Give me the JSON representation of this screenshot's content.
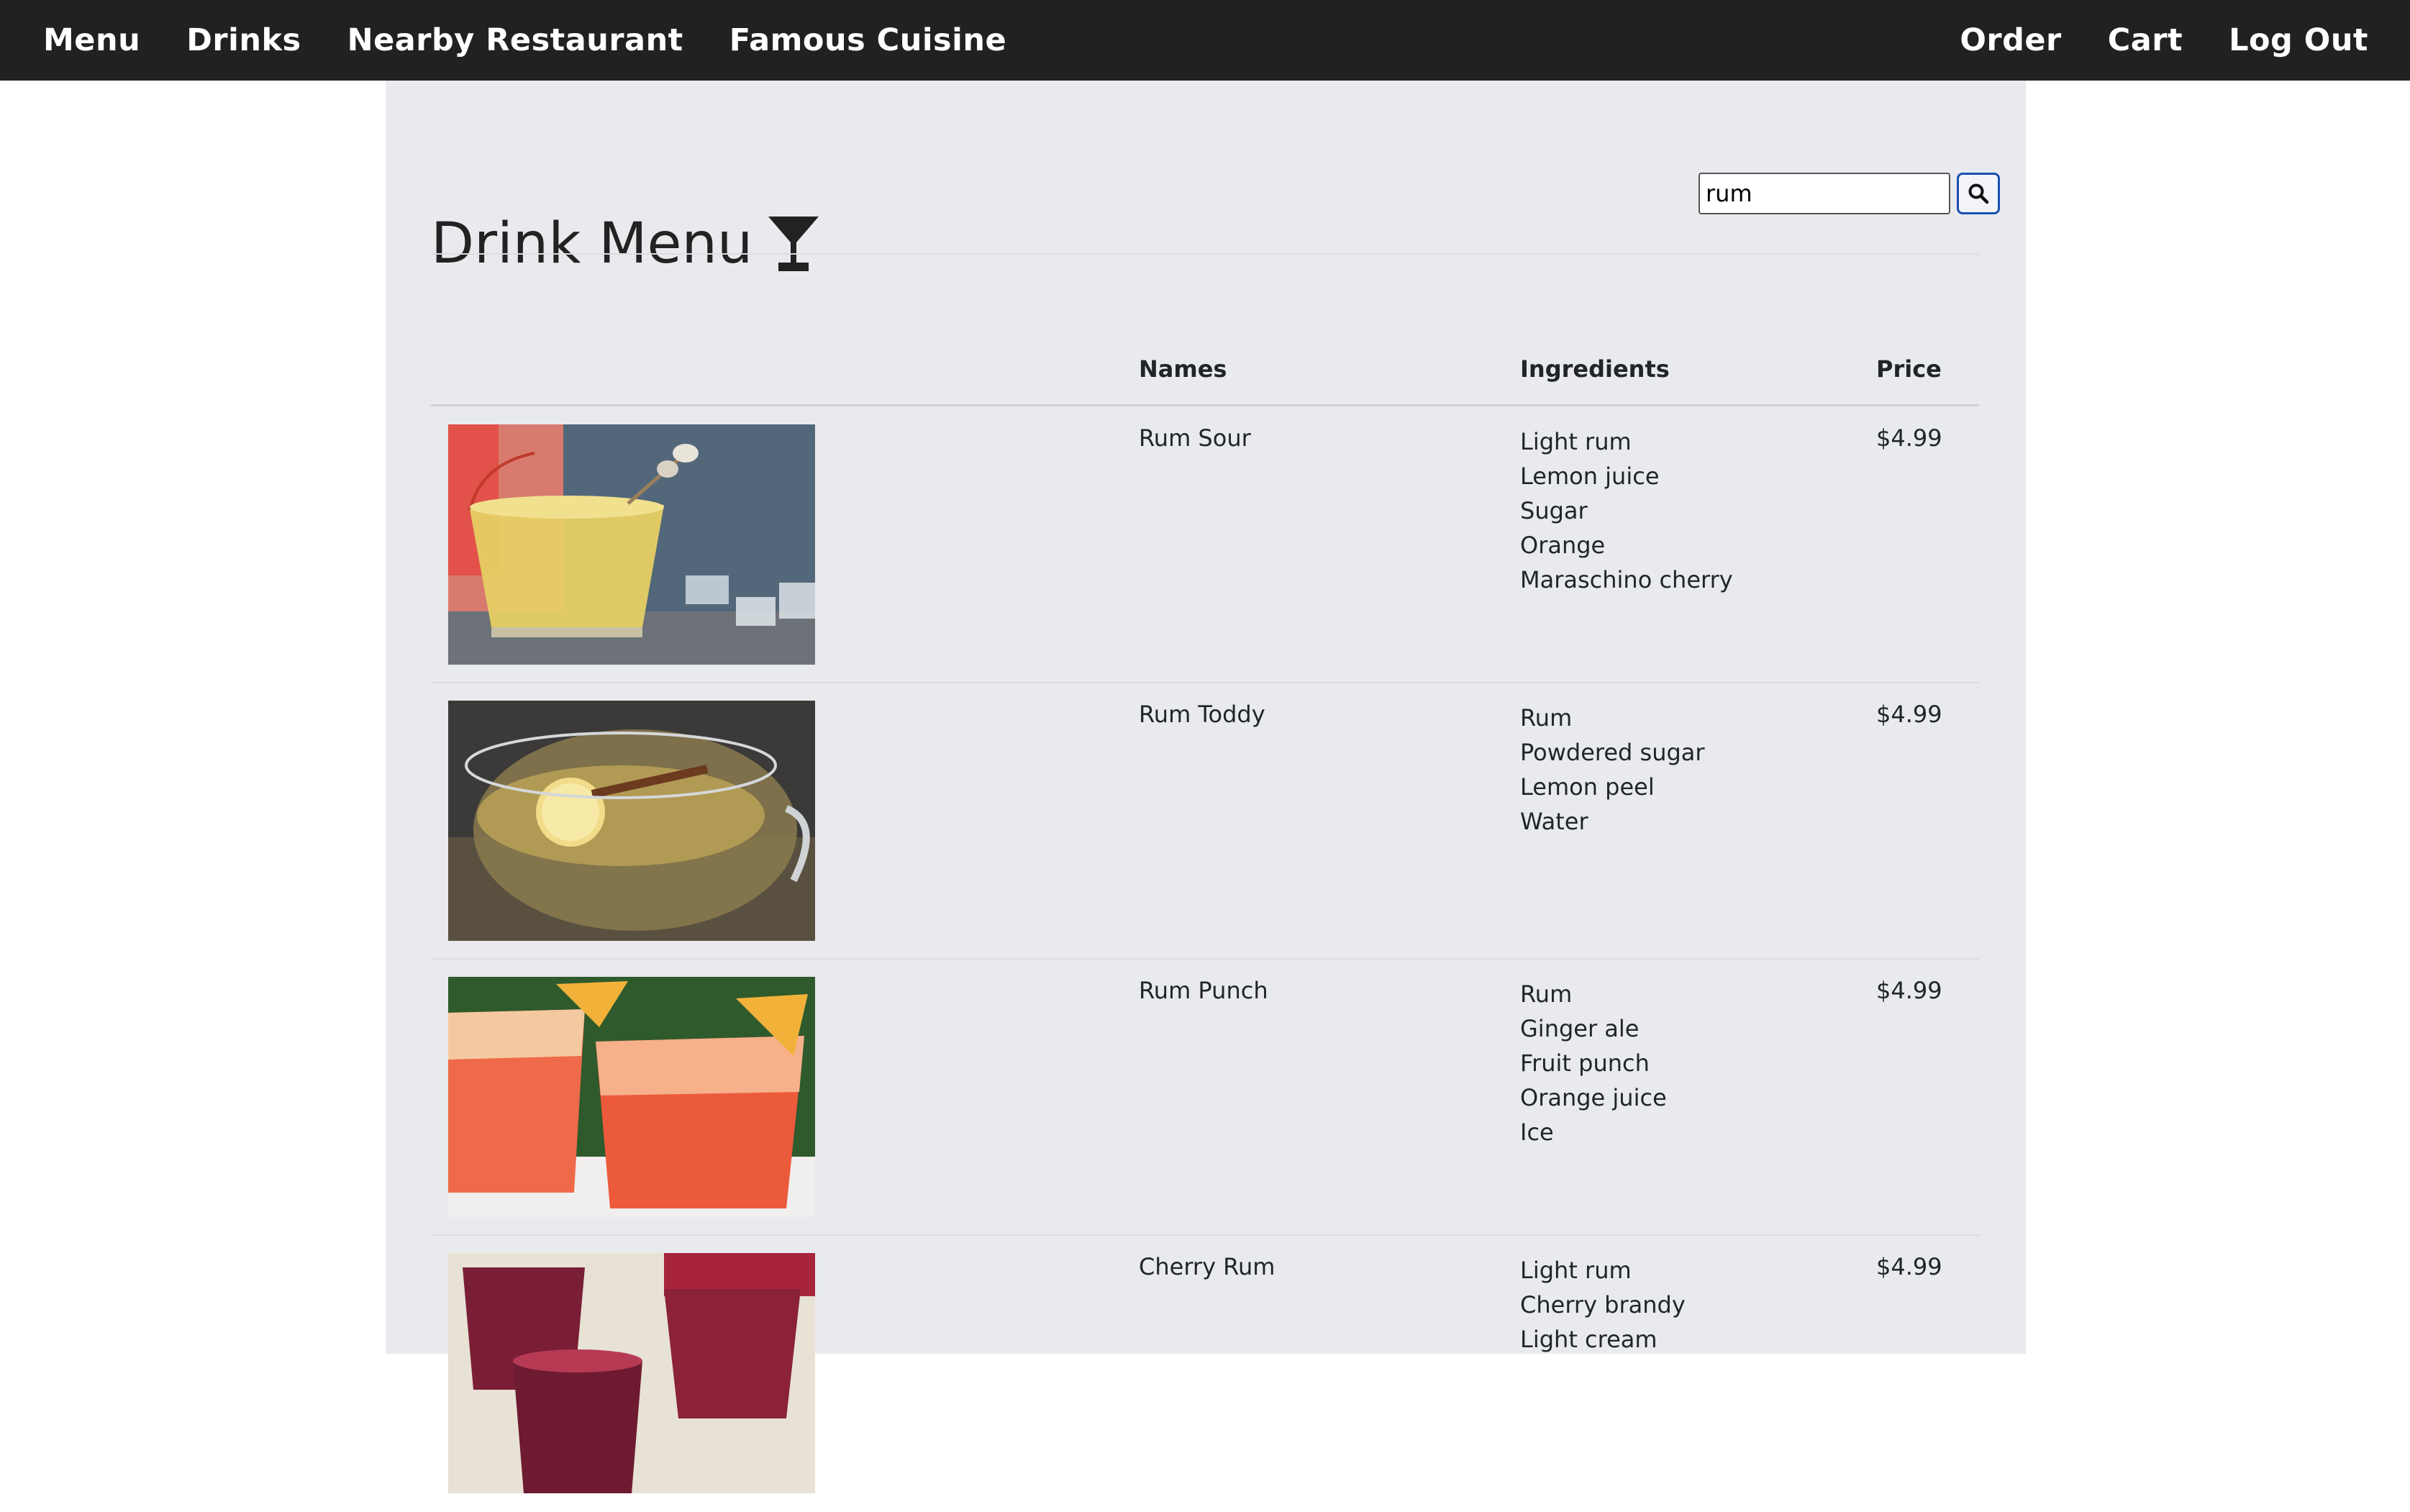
{
  "nav": {
    "left": [
      "Menu",
      "Drinks",
      "Nearby Restaurant",
      "Famous Cuisine"
    ],
    "right": [
      "Order",
      "Cart",
      "Log Out"
    ]
  },
  "page": {
    "title": "Drink Menu",
    "title_icon": "cocktail-glass-icon"
  },
  "search": {
    "value": "rum",
    "button_icon": "search-icon"
  },
  "table": {
    "headers": [
      "",
      "Names",
      "Ingredients",
      "Price"
    ],
    "rows": [
      {
        "name": "Rum Sour",
        "ingredients": [
          "Light rum",
          "Lemon juice",
          "Sugar",
          "Orange",
          "Maraschino cherry"
        ],
        "price": "$4.99"
      },
      {
        "name": "Rum Toddy",
        "ingredients": [
          "Rum",
          "Powdered sugar",
          "Lemon peel",
          "Water"
        ],
        "price": "$4.99"
      },
      {
        "name": "Rum Punch",
        "ingredients": [
          "Rum",
          "Ginger ale",
          "Fruit punch",
          "Orange juice",
          "Ice"
        ],
        "price": "$4.99"
      },
      {
        "name": "Cherry Rum",
        "ingredients": [
          "Light rum",
          "Cherry brandy",
          "Light cream"
        ],
        "price": "$4.99"
      }
    ]
  },
  "colors": {
    "navbar": "#212121",
    "content_bg": "#e9eaee",
    "search_button_border": "#1a4fb0"
  }
}
